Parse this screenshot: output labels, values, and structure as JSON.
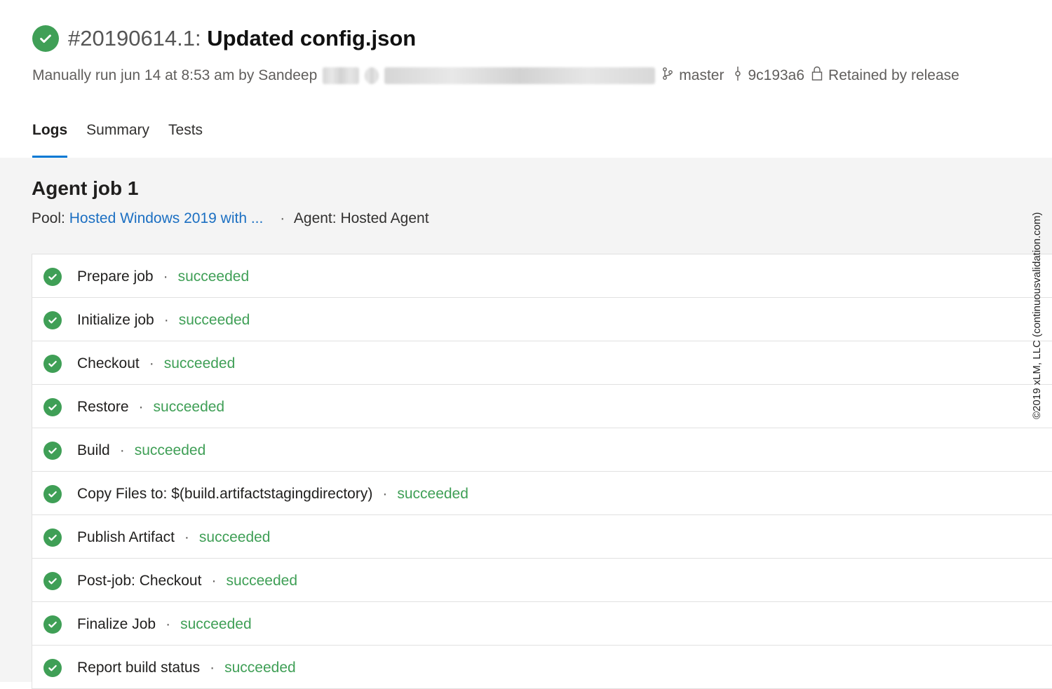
{
  "run": {
    "number": "#20190614.1:",
    "name": "Updated config.json",
    "trigger_text": "Manually run jun 14 at 8:53 am by Sandeep",
    "branch": "master",
    "commit": "9c193a6",
    "retention": "Retained by release"
  },
  "tabs": [
    {
      "label": "Logs"
    },
    {
      "label": "Summary"
    },
    {
      "label": "Tests"
    }
  ],
  "job": {
    "title": "Agent job 1",
    "pool_label": "Pool:",
    "pool_value": "Hosted Windows 2019 with ...",
    "agent_text": "Agent: Hosted Agent"
  },
  "steps": [
    {
      "name": "Prepare job",
      "status": "succeeded"
    },
    {
      "name": "Initialize job",
      "status": "succeeded"
    },
    {
      "name": "Checkout",
      "status": "succeeded"
    },
    {
      "name": "Restore",
      "status": "succeeded"
    },
    {
      "name": "Build",
      "status": "succeeded"
    },
    {
      "name": "Copy Files to: $(build.artifactstagingdirectory)",
      "status": "succeeded"
    },
    {
      "name": "Publish Artifact",
      "status": "succeeded"
    },
    {
      "name": "Post-job: Checkout",
      "status": "succeeded"
    },
    {
      "name": "Finalize Job",
      "status": "succeeded"
    },
    {
      "name": "Report build status",
      "status": "succeeded"
    }
  ],
  "watermark": "©2019 xLM, LLC (continuousvalidation.com)",
  "colors": {
    "success": "#3f9f56",
    "link": "#1b6fc2",
    "tab_accent": "#0078d4"
  },
  "icons": {
    "status": "check-circle-icon",
    "branch": "branch-icon",
    "commit": "commit-icon",
    "lock": "lock-icon"
  }
}
